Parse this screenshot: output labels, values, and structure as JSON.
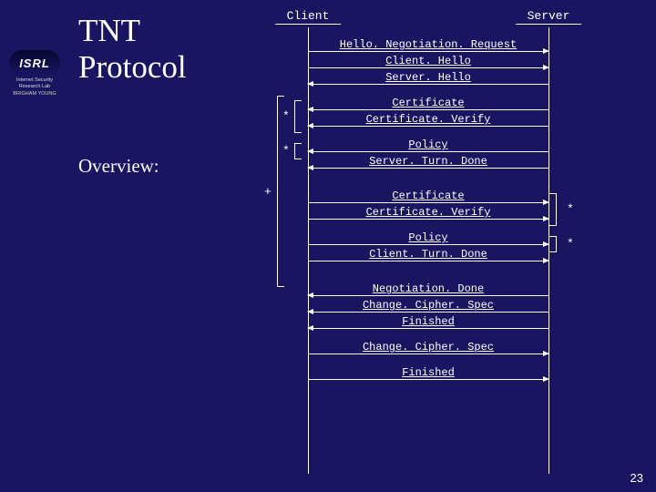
{
  "logo": {
    "name": "ISRL",
    "sub": "Internet Security Research Lab",
    "univ": "BRIGHAM YOUNG"
  },
  "title_l1": "TNT",
  "title_l2": "Protocol",
  "subtitle": "Overview:",
  "page_num": "23",
  "actors": {
    "client": "Client",
    "server": "Server"
  },
  "msgs": {
    "m1": "Hello. Negotiation. Request",
    "m2": "Client. Hello",
    "m3": "Server. Hello",
    "m4": "Certificate",
    "m5": "Certificate. Verify",
    "m6": "Policy",
    "m7": "Server. Turn. Done",
    "m8": "Certificate",
    "m9": "Certificate. Verify",
    "m10": "Policy",
    "m11": "Client. Turn. Done",
    "m12": "Negotiation. Done",
    "m13": "Change. Cipher. Spec",
    "m14": "Finished",
    "m15": "Change. Cipher. Spec",
    "m16": "Finished"
  },
  "markers": {
    "star": "*",
    "plus": "+"
  }
}
